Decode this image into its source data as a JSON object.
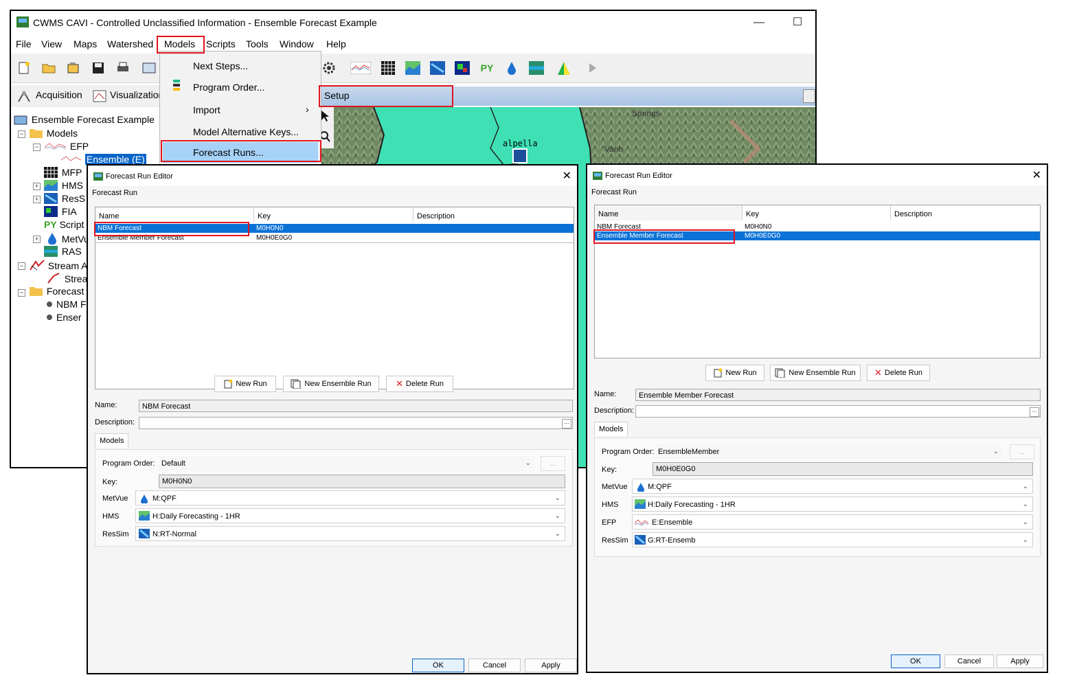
{
  "app": {
    "title": "CWMS CAVI - Controlled Unclassified Information - Ensemble Forecast Example",
    "menu": [
      "File",
      "View",
      "Maps",
      "Watershed",
      "Models",
      "Scripts",
      "Tools",
      "Window",
      "Help"
    ],
    "mode_tabs": [
      "Acquisition",
      "Visualization"
    ],
    "setup_tab": "Setup",
    "map_labels": [
      "Springs",
      "alpella",
      "Vann"
    ]
  },
  "tree": {
    "root": "Ensemble Forecast Example",
    "models": "Models",
    "efp": "EFP",
    "ensemble": "Ensemble (E)",
    "mfp": "MFP",
    "hms": "HMS",
    "ressim": "ResS",
    "fia": "FIA",
    "script": "Script",
    "metvue": "MetVu",
    "ras": "RAS",
    "stream": "Stream A",
    "stream_child": "Strea",
    "forecast": "Forecast",
    "nbm": "NBM F",
    "ensem": "Enser"
  },
  "dropdown": {
    "items": [
      "Next Steps...",
      "Program Order...",
      "Import",
      "Model Alternative Keys...",
      "Forecast Runs..."
    ]
  },
  "dialog1": {
    "title": "Forecast Run Editor",
    "group": "Forecast Run",
    "columns": [
      "Name",
      "Key",
      "Description"
    ],
    "rows": [
      {
        "name": "NBM Forecast",
        "key": "M0H0N0",
        "desc": ""
      },
      {
        "name": "Ensemble Member Forecast",
        "key": "M0H0E0G0",
        "desc": ""
      }
    ],
    "buttons": {
      "new_run": "New Run",
      "new_ensemble_run": "New Ensemble Run",
      "delete_run": "Delete Run"
    },
    "name_label": "Name:",
    "name_value": "NBM Forecast",
    "desc_label": "Description:",
    "models_tab": "Models",
    "program_order_label": "Program Order:",
    "program_order_value": "Default",
    "key_label": "Key:",
    "key_value": "M0H0N0",
    "models": [
      {
        "label": "MetVue",
        "value": "M:QPF",
        "icon": "metvue-icon"
      },
      {
        "label": "HMS",
        "value": "H:Daily Forecasting - 1HR",
        "icon": "hms-icon"
      },
      {
        "label": "ResSim",
        "value": "N:RT-Normal",
        "icon": "ressim-icon"
      }
    ],
    "ok": "OK",
    "cancel": "Cancel",
    "apply": "Apply"
  },
  "dialog2": {
    "title": "Forecast Run Editor",
    "group": "Forecast Run",
    "columns": [
      "Name",
      "Key",
      "Description"
    ],
    "rows": [
      {
        "name": "NBM Forecast",
        "key": "M0H0N0",
        "desc": ""
      },
      {
        "name": "Ensemble Member Forecast",
        "key": "M0H0E0G0",
        "desc": ""
      }
    ],
    "buttons": {
      "new_run": "New Run",
      "new_ensemble_run": "New Ensemble Run",
      "delete_run": "Delete Run"
    },
    "name_label": "Name:",
    "name_value": "Ensemble Member Forecast",
    "desc_label": "Description:",
    "models_tab": "Models",
    "program_order_label": "Program Order:",
    "program_order_value": "EnsembleMember",
    "key_label": "Key:",
    "key_value": "M0H0E0G0",
    "models": [
      {
        "label": "MetVue",
        "value": "M:QPF",
        "icon": "metvue-icon"
      },
      {
        "label": "HMS",
        "value": "H:Daily Forecasting - 1HR",
        "icon": "hms-icon"
      },
      {
        "label": "EFP",
        "value": "E:Ensemble",
        "icon": "efp-icon"
      },
      {
        "label": "ResSim",
        "value": "G:RT-Ensemb",
        "icon": "ressim-icon"
      }
    ],
    "ok": "OK",
    "cancel": "Cancel",
    "apply": "Apply"
  },
  "colors": {
    "highlight": "#e0141e",
    "selection": "#0a72d6",
    "map": "#3ee0b4"
  }
}
